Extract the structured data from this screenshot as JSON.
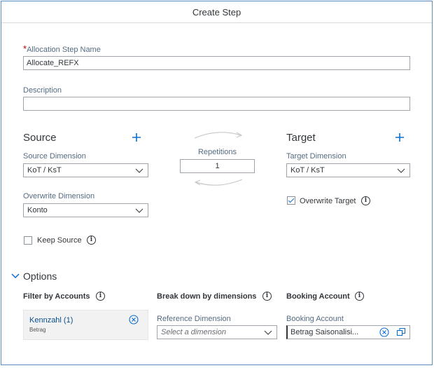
{
  "dialog": {
    "title": "Create Step"
  },
  "step_name": {
    "label": "Allocation Step Name",
    "value": "Allocate_REFX"
  },
  "description": {
    "label": "Description",
    "value": ""
  },
  "source": {
    "title": "Source",
    "dimension_label": "Source Dimension",
    "dimension_value": "KoT / KsT",
    "overwrite_label": "Overwrite Dimension",
    "overwrite_value": "Konto",
    "keep_source_label": "Keep Source",
    "keep_source_checked": false
  },
  "repetitions": {
    "label": "Repetitions",
    "value": "1"
  },
  "target": {
    "title": "Target",
    "dimension_label": "Target Dimension",
    "dimension_value": "KoT / KsT",
    "overwrite_target_label": "Overwrite Target",
    "overwrite_target_checked": true
  },
  "options": {
    "title": "Options",
    "filter_accounts_label": "Filter by Accounts",
    "filter_token": {
      "title": "Kennzahl (1)",
      "subtitle": "Betrag"
    },
    "breakdown_label": "Break down by dimensions",
    "reference_dimension_label": "Reference Dimension",
    "reference_dimension_placeholder": "Select a dimension",
    "booking_account_header": "Booking Account",
    "booking_account_label": "Booking Account",
    "booking_account_value": "Betrag Saisonalisi..."
  },
  "colors": {
    "accent": "#0a6ed1",
    "required": "#bb0000",
    "border": "#9fa5ab",
    "link": "#0a4f8f"
  }
}
